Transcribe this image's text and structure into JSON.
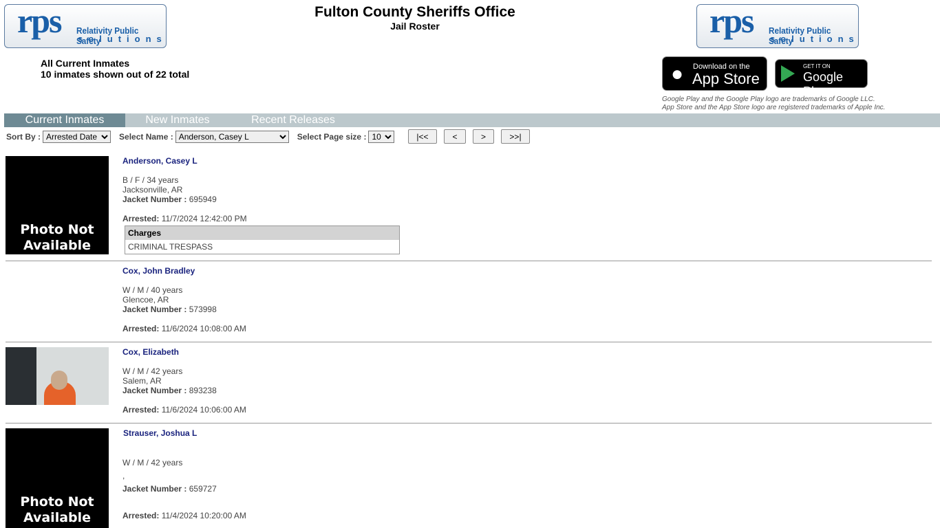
{
  "header": {
    "title": "Fulton County Sheriffs Office",
    "subtitle": "Jail Roster",
    "logo_text": "rps Relativity Public Safety solutions",
    "summary_title": "All Current Inmates",
    "summary_count": "10 inmates shown out of 22 total"
  },
  "badges": {
    "apple_small": "Download on the",
    "apple_big": "App Store",
    "google_small": "GET IT ON",
    "google_big": "Google Play",
    "tm1": "Google Play and the Google Play logo are trademarks of Google LLC.",
    "tm2": "App Store and the App Store logo are registered trademarks of Apple Inc."
  },
  "tabs": [
    {
      "label": "Current Inmates",
      "active": true
    },
    {
      "label": "New Inmates"
    },
    {
      "label": "Recent Releases"
    }
  ],
  "controls": {
    "sort_label": "Sort By :",
    "sort_value": "Arrested Date",
    "name_label": "Select Name :",
    "name_value": "Anderson, Casey L",
    "size_label": "Select Page size :",
    "size_value": "10",
    "first": "|<<",
    "prev": "<",
    "next": ">",
    "last": ">>|"
  },
  "labels": {
    "jacket": "Jacket Number :",
    "arrested": "Arrested:",
    "charges": "Charges",
    "photo_na": "Photo Not Available"
  },
  "inmates": [
    {
      "name": "Anderson, Casey L",
      "demo": "B / F / 34 years",
      "city": "Jacksonville, AR",
      "jacket": "695949",
      "arrested": "11/7/2024 12:42:00 PM",
      "charges": [
        "CRIMINAL TRESPASS"
      ],
      "photo": "not-available"
    },
    {
      "name": "Cox, John Bradley",
      "demo": "W / M / 40 years",
      "city": "Glencoe, AR",
      "jacket": "573998",
      "arrested": "11/6/2024 10:08:00 AM",
      "photo": "none"
    },
    {
      "name": "Cox, Elizabeth",
      "demo": "W / M / 42 years",
      "city": "Salem, AR",
      "jacket": "893238",
      "arrested": "11/6/2024 10:06:00 AM",
      "photo": "mugshot"
    },
    {
      "name": "Strauser, Joshua L",
      "demo": "W / M / 42 years",
      "city": ",",
      "jacket": "659727",
      "arrested": "11/4/2024 10:20:00 AM",
      "photo": "not-available"
    }
  ]
}
